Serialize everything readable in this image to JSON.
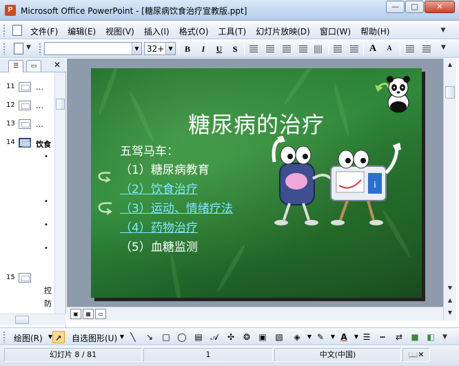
{
  "window": {
    "title": "Microsoft Office PowerPoint - [糖尿病饮食治疗宣教版.ppt]",
    "app_icon": "P",
    "minimize_glyph": "—",
    "maximize_glyph": "□",
    "close_glyph": "✕"
  },
  "menu": {
    "items": [
      "文件(F)",
      "编辑(E)",
      "视图(V)",
      "插入(I)",
      "格式(O)",
      "工具(T)",
      "幻灯片放映(D)",
      "窗口(W)",
      "帮助(H)"
    ],
    "help_dropdown": "▼"
  },
  "format_toolbar": {
    "font_name": "",
    "font_size": "32+",
    "dropdown_glyph": "▼",
    "bold": "B",
    "italic": "I",
    "underline": "U",
    "shadow": "S",
    "grow_font": "A",
    "shrink_font": "A"
  },
  "outline_panel": {
    "close_glyph": "✕",
    "rows": [
      {
        "num": "11",
        "text": "…"
      },
      {
        "num": "12",
        "text": "…"
      },
      {
        "num": "13",
        "text": "…"
      },
      {
        "num": "14",
        "text": "饮食"
      },
      {
        "num": "15",
        "text": ""
      }
    ],
    "bullet": "•",
    "tail_text_1": "控",
    "tail_text_2": "防"
  },
  "slide": {
    "title": "糖尿病的治疗",
    "intro": "五驾马车：",
    "items": [
      {
        "text": "（1）糖尿病教育",
        "link": false
      },
      {
        "text": "（2）饮食治疗",
        "link": true
      },
      {
        "text": "（3）运动、情绪疗法",
        "link": true
      },
      {
        "text": "（4）药物治疗",
        "link": true
      },
      {
        "text": "（5）血糖监测",
        "link": false
      }
    ]
  },
  "drawing_toolbar": {
    "draw_label": "绘图(R)",
    "autoshape_label": "自选图形(U)"
  },
  "status": {
    "slide_position": "幻灯片 8 / 81",
    "design": "1",
    "language": "中文(中国)"
  },
  "colors": {
    "slide_green": "#2f8a3b",
    "link_color": "#7fe8ff"
  }
}
